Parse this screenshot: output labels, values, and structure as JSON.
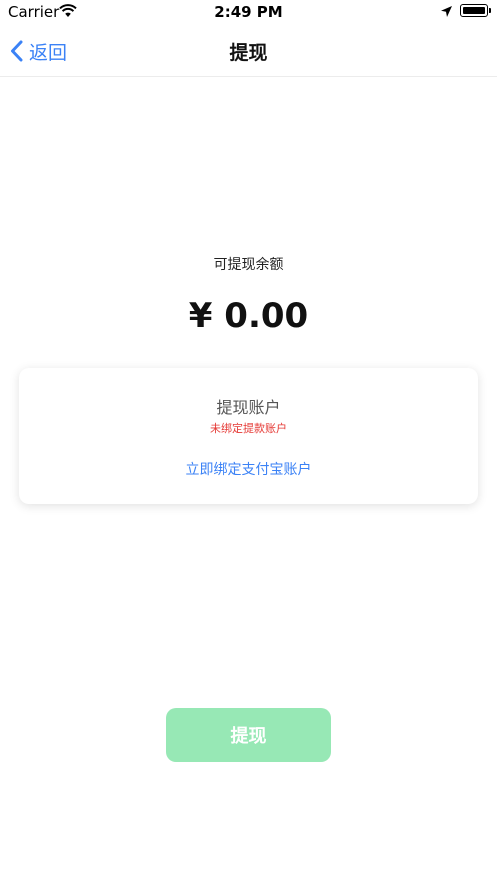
{
  "status_bar": {
    "carrier": "Carrier",
    "time": "2:49 PM"
  },
  "nav": {
    "back_label": "返回",
    "title": "提现"
  },
  "balance": {
    "label": "可提现余额",
    "amount": "¥ 0.00"
  },
  "account_card": {
    "title": "提现账户",
    "warning": "未绑定提款账户",
    "bind_link": "立即绑定支付宝账户"
  },
  "withdraw_button": {
    "label": "提现"
  },
  "colors": {
    "accent_blue": "#3b82f6",
    "warning_red": "#e53935",
    "button_green": "#97e8b5"
  },
  "icons": [
    "wifi-icon",
    "location-arrow-icon",
    "battery-icon",
    "back-chevron-icon"
  ]
}
